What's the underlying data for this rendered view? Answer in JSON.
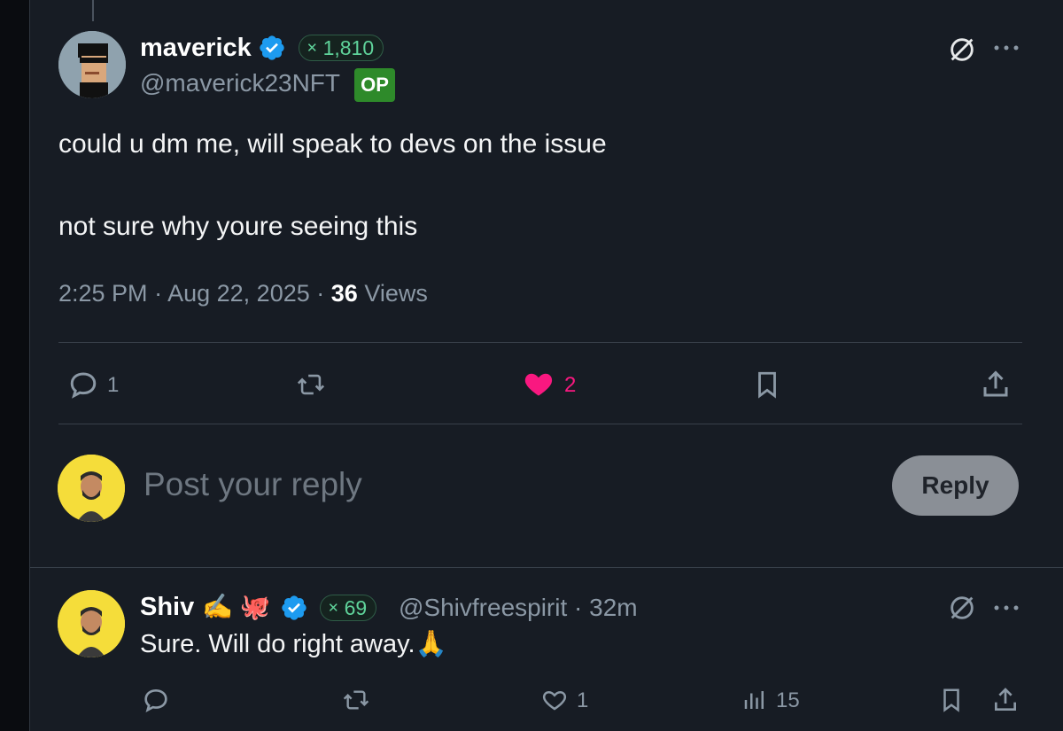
{
  "post": {
    "author_name": "maverick",
    "author_handle": "@maverick23NFT",
    "score": "1,810",
    "op_badge": "OP",
    "text_line1": "could u dm me, will speak to devs on the issue",
    "text_line2": "not sure why youre seeing this",
    "time": "2:25 PM",
    "date": "Aug 22, 2025",
    "views_count": "36",
    "views_label": "Views",
    "reply_count": "1",
    "like_count": "2"
  },
  "composer": {
    "placeholder": "Post your reply",
    "button_label": "Reply"
  },
  "reply": {
    "author_name": "Shiv",
    "name_emojis": "✍️ 🐙",
    "score": "69",
    "author_handle": "@Shivfreespirit",
    "age": "32m",
    "text": "Sure. Will do right away.",
    "text_emoji": "🙏",
    "like_count": "1",
    "views_count": "15"
  },
  "colors": {
    "background": "#171c24",
    "like_pink": "#f91880",
    "verified_blue": "#1d9bf0",
    "op_green": "#2e8a2a",
    "score_green": "#5fd39a"
  },
  "icons": [
    "reply-icon",
    "repost-icon",
    "heart-icon",
    "bookmark-icon",
    "share-icon",
    "grok-icon",
    "more-icon",
    "verified-icon",
    "views-icon"
  ]
}
